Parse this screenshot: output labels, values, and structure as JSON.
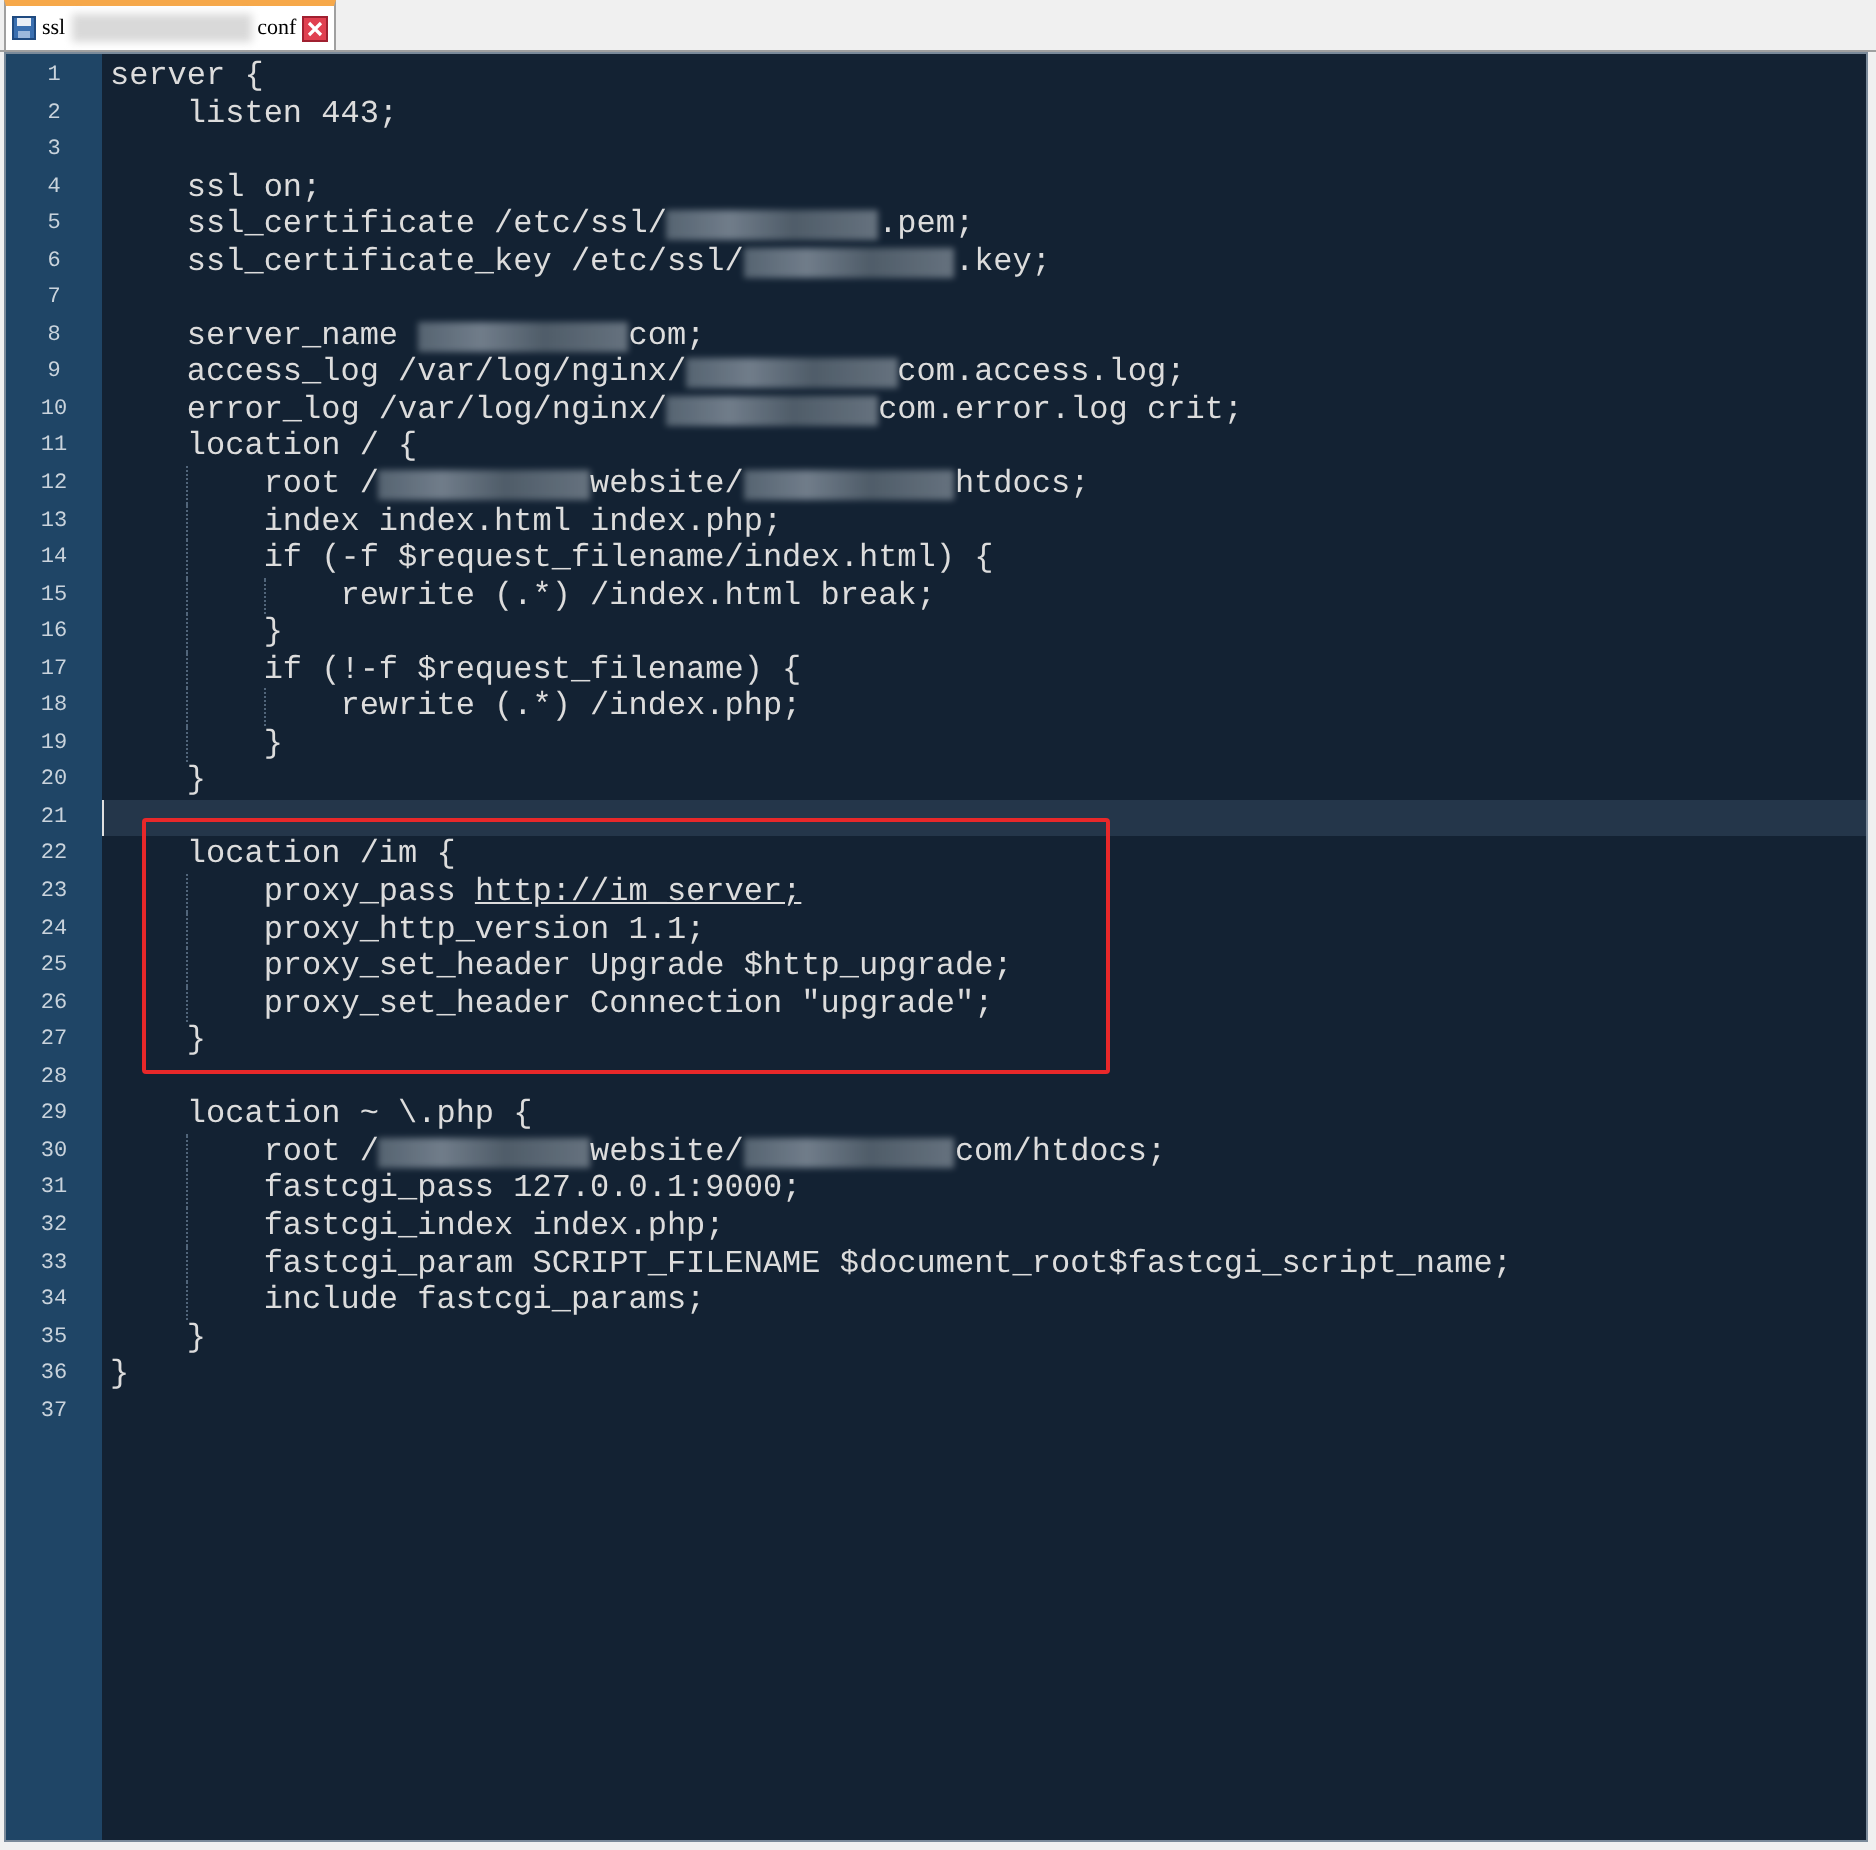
{
  "tab": {
    "title_start": "ssl",
    "title_end": "conf",
    "selected": true
  },
  "blocks": [
    {
      "kind": "plain",
      "lines": [
        {
          "n": "1",
          "text": "server {"
        },
        {
          "n": "2",
          "text": "    listen 443;"
        },
        {
          "n": "3"
        },
        {
          "n": "4",
          "text": "    ssl on;"
        },
        {
          "n": "5",
          "parts": [
            {
              "kind": "text",
              "text": "    ssl_certificate /etc/ssl/"
            },
            {
              "kind": "redaction"
            },
            {
              "kind": "text",
              "text": ".pem;"
            }
          ]
        },
        {
          "n": "6",
          "parts": [
            {
              "kind": "text",
              "text": "    ssl_certificate_key /etc/ssl/"
            },
            {
              "kind": "redaction"
            },
            {
              "kind": "text",
              "text": ".key;"
            }
          ]
        },
        {
          "n": "7"
        },
        {
          "n": "8",
          "parts": [
            {
              "kind": "text",
              "text": "    server_name "
            },
            {
              "kind": "redaction"
            },
            {
              "kind": "text",
              "text": "com;"
            }
          ]
        },
        {
          "n": "9",
          "parts": [
            {
              "kind": "text",
              "text": "    access_log /var/log/nginx/"
            },
            {
              "kind": "redaction"
            },
            {
              "kind": "text",
              "text": "com.access.log;"
            }
          ]
        },
        {
          "n": "10",
          "parts": [
            {
              "kind": "text",
              "text": "    error_log /var/log/nginx/"
            },
            {
              "kind": "redaction"
            },
            {
              "kind": "text",
              "text": "com.error.log crit;"
            }
          ]
        },
        {
          "n": "11",
          "text": "    location / {"
        },
        {
          "n": "12",
          "parts": [
            {
              "kind": "text",
              "text": "        root /"
            },
            {
              "kind": "redaction"
            },
            {
              "kind": "text",
              "text": "website/"
            },
            {
              "kind": "redaction"
            },
            {
              "kind": "text",
              "text": "htdocs;"
            }
          ]
        },
        {
          "n": "13",
          "text": "        index index.html index.php;"
        },
        {
          "n": "14",
          "text": "        if (-f $request_filename/index.html) {"
        },
        {
          "n": "15",
          "text": "            rewrite (.*) /index.html break;"
        },
        {
          "n": "16",
          "text": "        }"
        },
        {
          "n": "17",
          "text": "        if (!-f $request_filename) {"
        },
        {
          "n": "18",
          "text": "            rewrite (.*) /index.php;"
        },
        {
          "n": "19",
          "text": "        }"
        },
        {
          "n": "20",
          "text": "    }"
        },
        {
          "n": "21",
          "current": true
        }
      ]
    },
    {
      "kind": "boxed",
      "lines": [
        {
          "n": "22",
          "text": "    location /im {"
        },
        {
          "n": "23",
          "parts": [
            {
              "kind": "text",
              "text": "        proxy_pass "
            },
            {
              "kind": "link",
              "text": "http://im_server;"
            }
          ]
        },
        {
          "n": "24",
          "text": "        proxy_http_version 1.1;"
        },
        {
          "n": "25",
          "text": "        proxy_set_header Upgrade $http_upgrade;"
        },
        {
          "n": "26",
          "text": "        proxy_set_header Connection \"upgrade\";"
        },
        {
          "n": "27",
          "text": "    }"
        }
      ]
    },
    {
      "kind": "plain",
      "lines": [
        {
          "n": "28"
        },
        {
          "n": "29",
          "text": "    location ~ \\.php {"
        },
        {
          "n": "30",
          "parts": [
            {
              "kind": "text",
              "text": "        root /"
            },
            {
              "kind": "redaction"
            },
            {
              "kind": "text",
              "text": "website/"
            },
            {
              "kind": "redaction"
            },
            {
              "kind": "text",
              "text": "com/htdocs;"
            }
          ]
        },
        {
          "n": "31",
          "text": "        fastcgi_pass 127.0.0.1:9000;"
        },
        {
          "n": "32",
          "text": "        fastcgi_index index.php;"
        },
        {
          "n": "33",
          "text": "        fastcgi_param SCRIPT_FILENAME $document_root$fastcgi_script_name;"
        },
        {
          "n": "34",
          "text": "        include fastcgi_params;"
        },
        {
          "n": "35",
          "text": "    }"
        },
        {
          "n": "36",
          "text": "}"
        },
        {
          "n": "37"
        }
      ]
    }
  ]
}
